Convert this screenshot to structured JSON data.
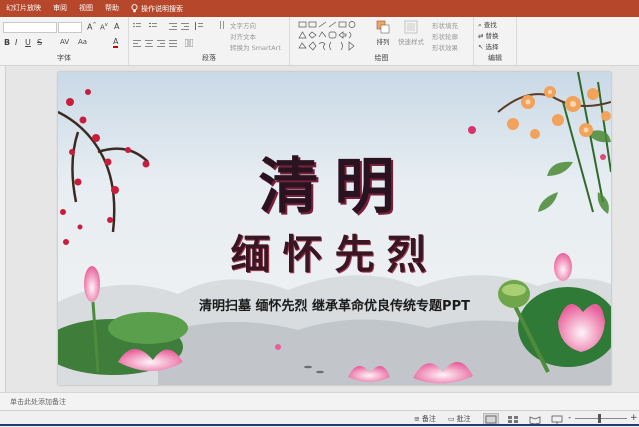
{
  "menu": {
    "tabs": [
      "幻灯片放映",
      "审阅",
      "视图",
      "帮助"
    ],
    "tell_me": "操作说明搜索"
  },
  "ribbon": {
    "groups": {
      "font": "字体",
      "paragraph": "段落",
      "drawing": "绘图",
      "editing": "编辑"
    },
    "paragraph_controls": {
      "text_direction": "文字方向",
      "align_text": "对齐文本",
      "smartart": "转换为 SmartArt"
    },
    "drawing_controls": {
      "arrange": "排列",
      "quick_styles": "快速样式",
      "shape_fill": "形状填充",
      "shape_outline": "形状轮廓",
      "shape_effects": "形状效果"
    },
    "editing_controls": {
      "find": "查找",
      "replace": "替换",
      "select": "选择"
    }
  },
  "slide": {
    "title": "清明",
    "subtitle_calligraphy": "缅怀先烈",
    "caption": "清明扫墓  缅怀先烈  继承革命优良传统专题PPT"
  },
  "notes_placeholder": "单击此处添加备注",
  "status": {
    "notes_label": "备注",
    "comments_label": "批注"
  },
  "colors": {
    "accent": "#b7472a",
    "ribbon_bg": "#f3f3f3",
    "title_ink": "#2a1320"
  }
}
